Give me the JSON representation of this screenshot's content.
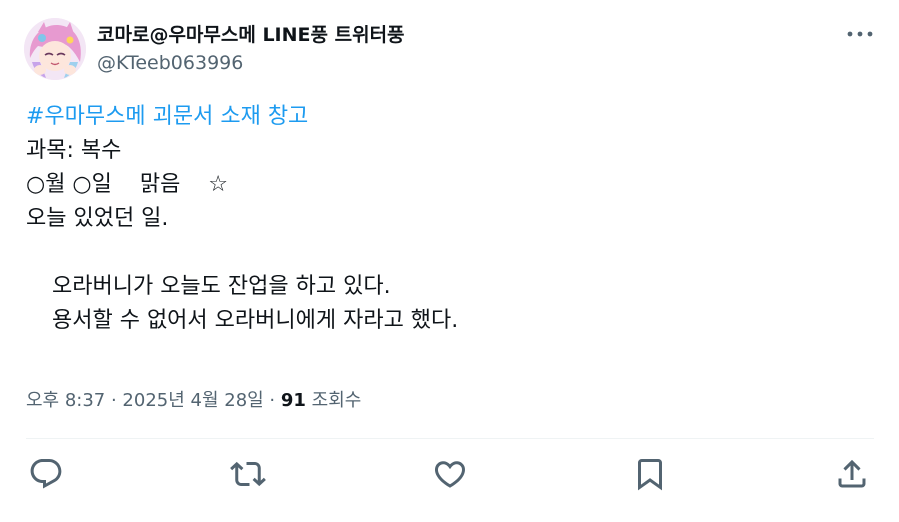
{
  "author": {
    "display_name": "코마로@우마무스메 LINE풍 트위터풍",
    "handle": "@KTeeb063996"
  },
  "tweet": {
    "hashtag": "#우마무스메 괴문서 소재 창고",
    "lines": {
      "subject": "과목: 복수",
      "date_weather": "○월 ○일    맑음    ☆",
      "today": "오늘 있었던 일.",
      "para1": "오라버니가 오늘도 잔업을 하고 있다.",
      "para2": "용서할 수 없어서 오라버니에게 자라고 했다."
    }
  },
  "meta": {
    "timestamp": "오후 8:37 · 2025년 4월 28일 · ",
    "views_count": "91",
    "views_label": " 조회수"
  },
  "icons": {
    "more": "more-horizontal-icon",
    "reply": "reply-icon",
    "retweet": "retweet-icon",
    "like": "heart-icon",
    "bookmark": "bookmark-icon",
    "share": "share-icon"
  },
  "colors": {
    "hashtag": "#1d9bf0",
    "secondary_text": "#536471",
    "primary_text": "#0f1419",
    "icon": "#536471"
  }
}
